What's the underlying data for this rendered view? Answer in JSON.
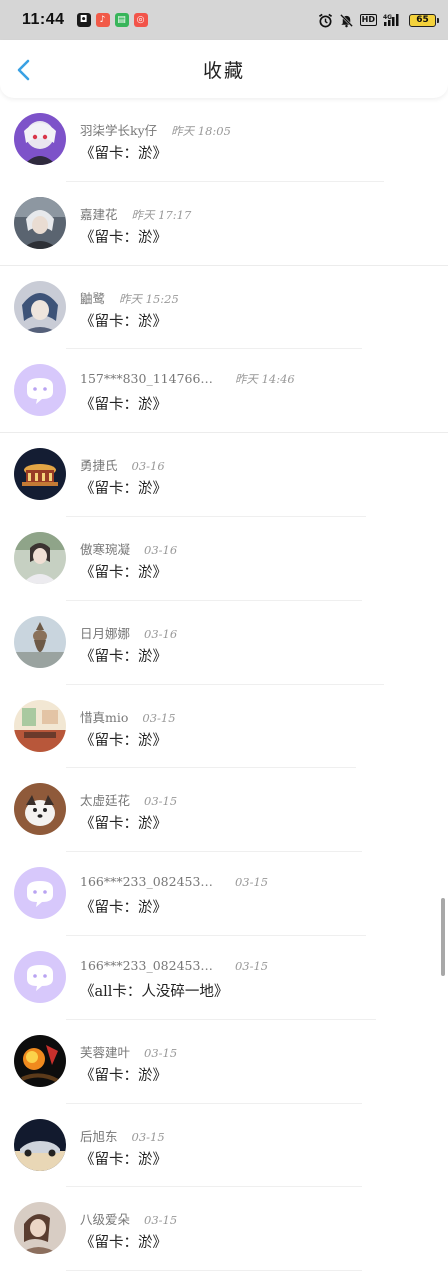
{
  "status_bar": {
    "time": "11:44",
    "network": "4G",
    "battery": "65",
    "hd": "HD",
    "app_icons": [
      {
        "name": "notification-app-icon-1",
        "color": "#1a1a1a",
        "glyph": "◘"
      },
      {
        "name": "notification-app-icon-2",
        "color": "#f15a48",
        "glyph": "♪"
      },
      {
        "name": "notification-app-icon-3",
        "color": "#38b55a",
        "glyph": "▤"
      },
      {
        "name": "notification-app-icon-4",
        "color": "#f2544a",
        "glyph": "◎"
      }
    ]
  },
  "header": {
    "title": "收藏"
  },
  "favorites": [
    {
      "name": "羽柒学长ky仔",
      "time": "昨天 18:05",
      "content": "《留卡：淤》",
      "avatar": "anime-purple"
    },
    {
      "name": "嘉建花",
      "time": "昨天 17:17",
      "content": "《留卡：淤》",
      "avatar": "white-hair"
    },
    {
      "name": "鼬鹭",
      "time": "昨天 15:25",
      "content": "《留卡：淤》",
      "avatar": "blue-hair"
    },
    {
      "name": "157***830_114766…",
      "time": "昨天 14:46",
      "content": "《留卡：淤》",
      "avatar": "default"
    },
    {
      "name": "勇捷氏",
      "time": "03-16",
      "content": "《留卡：淤》",
      "avatar": "carousel"
    },
    {
      "name": "傲寒琬凝",
      "time": "03-16",
      "content": "《留卡：淤》",
      "avatar": "girl-photo"
    },
    {
      "name": "日月娜娜",
      "time": "03-16",
      "content": "《留卡：淤》",
      "avatar": "cat"
    },
    {
      "name": "惜真mio",
      "time": "03-15",
      "content": "《留卡：淤》",
      "avatar": "room"
    },
    {
      "name": "太虚廷花",
      "time": "03-15",
      "content": "《留卡：淤》",
      "avatar": "dog"
    },
    {
      "name": "166***233_082453…",
      "time": "03-15",
      "content": "《留卡：淤》",
      "avatar": "default"
    },
    {
      "name": "166***233_082453…",
      "time": "03-15",
      "content": "《all卡：人没碎一地》",
      "avatar": "default"
    },
    {
      "name": "芙蓉建叶",
      "time": "03-15",
      "content": "《留卡：淤》",
      "avatar": "fire"
    },
    {
      "name": "后旭东",
      "time": "03-15",
      "content": "《留卡：淤》",
      "avatar": "car"
    },
    {
      "name": "八级爱朵",
      "time": "03-15",
      "content": "《留卡：淤》",
      "avatar": "portrait"
    }
  ]
}
